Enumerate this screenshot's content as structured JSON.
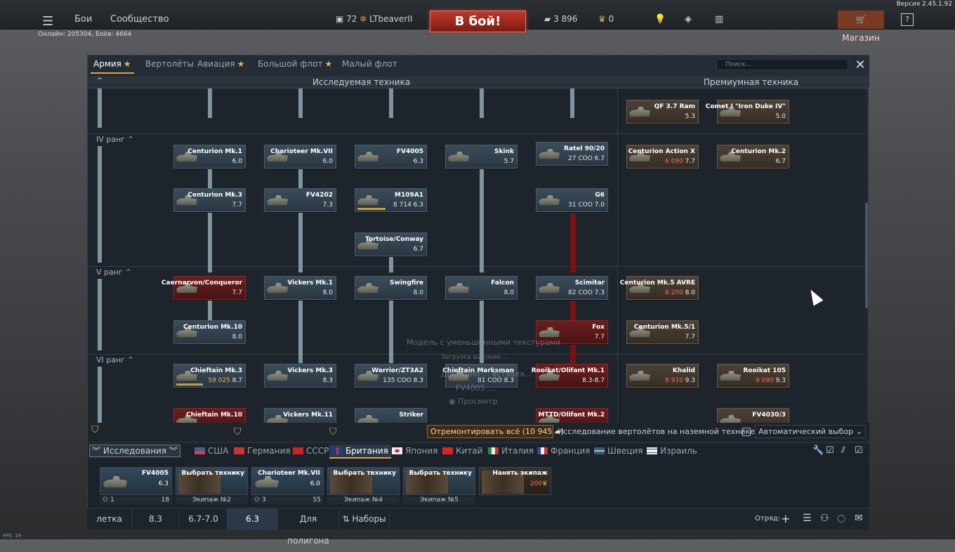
{
  "app": {
    "version": "Версия 2.45.1.92",
    "online": "Онлайн: 205304, Боёв: 4664",
    "fps": "FPS: 19"
  },
  "topbar": {
    "battles": "Бои",
    "community": "Сообщество",
    "level": "72",
    "nickname": "LTbeaverII",
    "battle_button": "В бой!",
    "silver": "3 896",
    "gold": "0",
    "shop": "Магазин",
    "help": "?"
  },
  "tabs": [
    {
      "label": "Армия",
      "star": true,
      "active": true
    },
    {
      "label": "Вертолёты",
      "star": false
    },
    {
      "label": "Авиация",
      "star": true
    },
    {
      "label": "Большой флот",
      "star": true
    },
    {
      "label": "Малый флот",
      "star": false
    }
  ],
  "search": {
    "placeholder": "Поиск..."
  },
  "columns": {
    "researched": "Исследуемая техника",
    "premium": "Премиумная техника"
  },
  "ranks": [
    "IV ранг",
    "V ранг",
    "VI ранг"
  ],
  "vehicles": [
    {
      "name": "Centurion Mk.1",
      "br": "6.0"
    },
    {
      "name": "Charioteer Mk.VII",
      "br": "6.0"
    },
    {
      "name": "FV4005",
      "br": "6.3"
    },
    {
      "name": "Skink",
      "br": "5.7"
    },
    {
      "name": "Ratel 90/20",
      "cost": "27 СОО",
      "br": "6.7"
    },
    {
      "name": "Centurion Mk.3",
      "br": "7.7"
    },
    {
      "name": "FV4202",
      "br": "7.3"
    },
    {
      "name": "M109A1",
      "cost": "8 714",
      "br": "6.3"
    },
    {
      "name": "G6",
      "cost": "31 СОО",
      "br": "7.0"
    },
    {
      "name": "Tortoise/Conway",
      "br": "6.7"
    },
    {
      "name": "Caernarvon/Conqueror",
      "br": "7.7"
    },
    {
      "name": "Vickers Mk.1",
      "br": "8.0"
    },
    {
      "name": "Swingfire",
      "br": "8.0"
    },
    {
      "name": "Falcon",
      "br": "8.0"
    },
    {
      "name": "Scimitar",
      "cost": "82 СОО",
      "br": "7.3"
    },
    {
      "name": "Centurion Mk.10",
      "br": "8.0"
    },
    {
      "name": "Fox",
      "br": "7.7"
    },
    {
      "name": "Chieftain Mk.3",
      "cost": "59 025",
      "br": "8.7"
    },
    {
      "name": "Vickers Mk.3",
      "br": "8.3"
    },
    {
      "name": "Warrior/ZT3A2",
      "cost": "135 СОО",
      "br": "8.3"
    },
    {
      "name": "Chieftain Marksman",
      "cost": "81 СОО",
      "br": "8.3"
    },
    {
      "name": "Rooikat/Olifant Mk.1",
      "br": "8.3-8.7"
    },
    {
      "name": "Chieftain Mk.10",
      "br": ""
    },
    {
      "name": "Vickers Mk.11",
      "br": ""
    },
    {
      "name": "Striker",
      "br": ""
    },
    {
      "name": "MTTD/Olifant Mk.2",
      "br": ""
    }
  ],
  "premium": [
    {
      "name": "QF 3.7 Ram",
      "br": "5.3"
    },
    {
      "name": "Comet I \"Iron Duke IV\"",
      "br": "5.0"
    },
    {
      "name": "Centurion Action X",
      "cost": "6 090",
      "br": "7.7"
    },
    {
      "name": "Centurion Mk.2",
      "br": "6.7"
    },
    {
      "name": "Centurion Mk.5 AVRE",
      "cost": "8 200",
      "br": "8.0"
    },
    {
      "name": "Centurion Mk.5/1",
      "br": "7.7"
    },
    {
      "name": "Khalid",
      "cost": "8 910",
      "br": "9.3"
    },
    {
      "name": "Rooikat 105",
      "cost": "9 090",
      "br": "9.3"
    },
    {
      "name": "FV4030/3",
      "br": ""
    }
  ],
  "ghost": {
    "line1": "Модель с уменьшенными текстурами",
    "line2": "Загрузка высоких ...",
    "line3": "Доступно ... вставля...",
    "line4": "FV4005 ... ",
    "view": "Просмотр"
  },
  "bottom": {
    "repair": "Отремонтировать всё (10 945",
    "heli": "Исследование вертолётов на наземной технике",
    "auto": "Автоматический выбор"
  },
  "research_btn": "Исследования",
  "nations": [
    "США",
    "Германия",
    "СССР",
    "Британия",
    "Япония",
    "Китай",
    "Италия",
    "Франция",
    "Швеция",
    "Израиль"
  ],
  "crew": [
    {
      "name": "FV4005",
      "br": "6.3",
      "count": "1",
      "level": "18",
      "label": ""
    },
    {
      "name": "Выбрать технику",
      "label": "Экипаж №2"
    },
    {
      "name": "Charioteer Mk.VII",
      "br": "6.0",
      "count": "3",
      "level": "55",
      "label": ""
    },
    {
      "name": "Выбрать технику",
      "label": "Экипаж №4"
    },
    {
      "name": "Выбрать технику",
      "label": "Экипаж №5"
    },
    {
      "name": "Нанять экипаж",
      "cost": "200"
    }
  ],
  "presets": [
    "летка",
    "8.3",
    "6.7-7.0",
    "6.3",
    "Для полигона",
    "Наборы"
  ],
  "squad": "Отряд:"
}
